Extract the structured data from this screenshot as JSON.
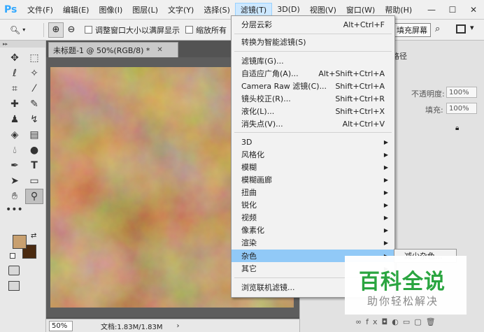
{
  "app": {
    "logo": "Ps"
  },
  "menubar": {
    "items": [
      "文件(F)",
      "编辑(E)",
      "图像(I)",
      "图层(L)",
      "文字(Y)",
      "选择(S)",
      "滤镜(T)",
      "3D(D)",
      "视图(V)",
      "窗口(W)",
      "帮助(H)"
    ],
    "active_index": 6,
    "window_controls": [
      "minimize-icon",
      "maximize-icon",
      "close-icon"
    ]
  },
  "options_bar": {
    "zoom_icon": "zoom-icon",
    "resize_window_label": "调整窗口大小以满屏显示",
    "zoom_all_label": "缩放所有",
    "fill_screen_label": "填充屏幕"
  },
  "document": {
    "tab_title": "未标题-1 @ 50%(RGB/8) *",
    "zoom": "50%",
    "doc_info": "文档:1.83M/1.83M"
  },
  "colors": {
    "foreground": "#c8a070",
    "background": "#4a2a10",
    "menu_highlight": "#91c9f7"
  },
  "filter_menu": {
    "items": [
      {
        "label": "分层云彩",
        "shortcut": "Alt+Ctrl+F"
      },
      {
        "label": "转换为智能滤镜(S)",
        "shortcut": ""
      },
      {
        "label": "滤镜库(G)...",
        "shortcut": ""
      },
      {
        "label": "自适应广角(A)...",
        "shortcut": "Alt+Shift+Ctrl+A"
      },
      {
        "label": "Camera Raw 滤镜(C)...",
        "shortcut": "Shift+Ctrl+A"
      },
      {
        "label": "镜头校正(R)...",
        "shortcut": "Shift+Ctrl+R"
      },
      {
        "label": "液化(L)...",
        "shortcut": "Shift+Ctrl+X"
      },
      {
        "label": "消失点(V)...",
        "shortcut": "Alt+Ctrl+V"
      },
      {
        "label": "3D",
        "submenu": true
      },
      {
        "label": "风格化",
        "submenu": true
      },
      {
        "label": "模糊",
        "submenu": true
      },
      {
        "label": "模糊画廊",
        "submenu": true
      },
      {
        "label": "扭曲",
        "submenu": true
      },
      {
        "label": "锐化",
        "submenu": true
      },
      {
        "label": "视频",
        "submenu": true
      },
      {
        "label": "像素化",
        "submenu": true
      },
      {
        "label": "渲染",
        "submenu": true
      },
      {
        "label": "杂色",
        "submenu": true,
        "highlighted": true
      },
      {
        "label": "其它",
        "submenu": true
      },
      {
        "label": "浏览联机滤镜...",
        "shortcut": ""
      }
    ],
    "submenu_first_item": "减少杂色..."
  },
  "right_panel": {
    "tab_label": "路径",
    "opacity_label": "不透明度:",
    "opacity_value": "100%",
    "fill_label": "填充:",
    "fill_value": "100%"
  },
  "watermark": {
    "title": "百科全说",
    "subtitle": "助你轻松解决"
  }
}
